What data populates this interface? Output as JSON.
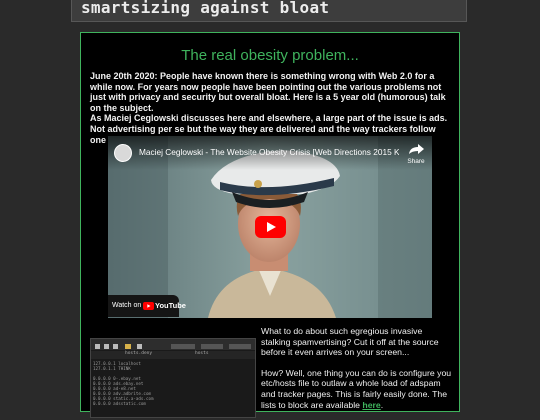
{
  "header": {
    "site_title": "smartsizing against bloat"
  },
  "article": {
    "heading": "The real obesity problem...",
    "intro_p1": "June 20th 2020: People have known there is something wrong with Web 2.0 for a while now. For years now people have been pointing out the various problems not just with privacy and security but overall bloat. Here is a 5 year old (humorous) talk on the subject.",
    "intro_p2": "As Maciej Ceglowski discusses here and elsewhere, a large part of the issue is ads. Not advertising per se but the way they are delivered and the way trackers follow one around the interweb.",
    "video": {
      "title": "Maciej Ceglowski - The Website Obesity Crisis [Web Directions 2015 Keynote]",
      "share_label": "Share",
      "watch_on_label": "Watch on",
      "youtube_label": "YouTube"
    },
    "terminal": {
      "tabs": [
        "hosts.deny",
        "hosts"
      ],
      "lines": [
        "127.0.0.1   localhost",
        "127.0.1.1   THINK",
        "",
        "0.0.0.0 0-.ebay.net",
        "0.0.0.0 ads.ebay.net",
        "0.0.0.0 ad-e8.net",
        "0.0.0.0 adv.adbrite.com",
        "0.0.0.0 static.a-ads.com",
        "0.0.0.0 adsstatic.com"
      ]
    },
    "side_p1": "What to do about such egregious invasive stalking spamvertising? Cut it off at the source before it even arrives on your screen...",
    "side_p2_text": "How? Well, one thing you can do is configure you etc/hosts file to outlaw a whole load of adspam and tracker pages. This is fairly easily done. The lists to block are available ",
    "side_p2_link": "here",
    "side_p2_end": "."
  },
  "colors": {
    "accent": "#3fb35d",
    "background": "#2a2a2a",
    "panel": "#000000",
    "youtube_red": "#ff0000"
  }
}
